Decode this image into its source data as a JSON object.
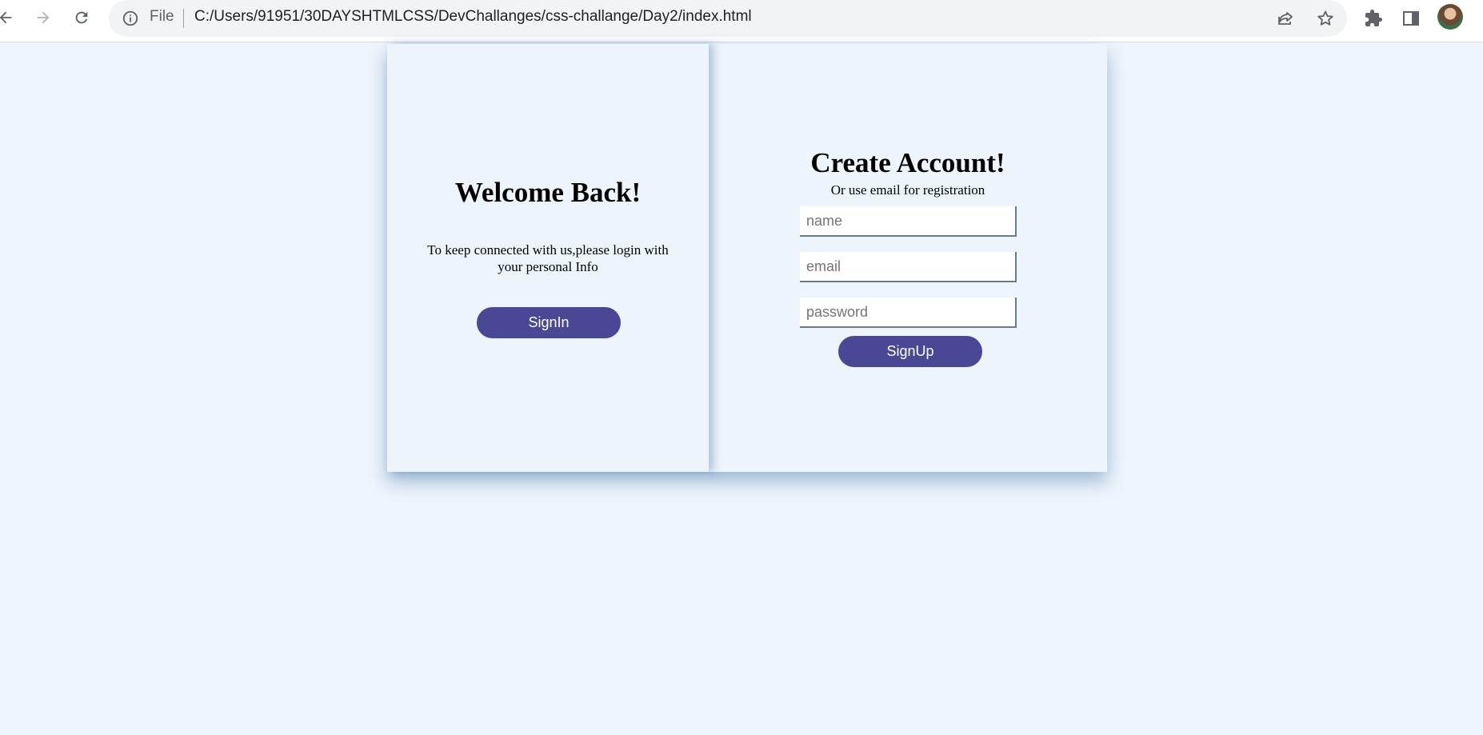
{
  "browser": {
    "file_label": "File",
    "url": "C:/Users/91951/30DAYSHTMLCSS/DevChallanges/css-challange/Day2/index.html",
    "icons": [
      "back-arrow-icon",
      "forward-arrow-icon",
      "reload-icon",
      "info-icon",
      "share-icon",
      "star-icon",
      "extensions-icon",
      "side-panel-icon",
      "avatar"
    ]
  },
  "signin_panel": {
    "title": "Welcome Back!",
    "text": "To keep connected with us,please login with your personal Info",
    "button_label": "SignIn"
  },
  "signup_panel": {
    "title": "Create Account!",
    "subtitle": "Or use email for registration",
    "fields": {
      "name_placeholder": "name",
      "email_placeholder": "email",
      "password_placeholder": "password"
    },
    "button_label": "SignUp"
  },
  "colors": {
    "page_bg": "#eef5fd",
    "button_bg": "#484894",
    "button_text": "#ffffff"
  }
}
